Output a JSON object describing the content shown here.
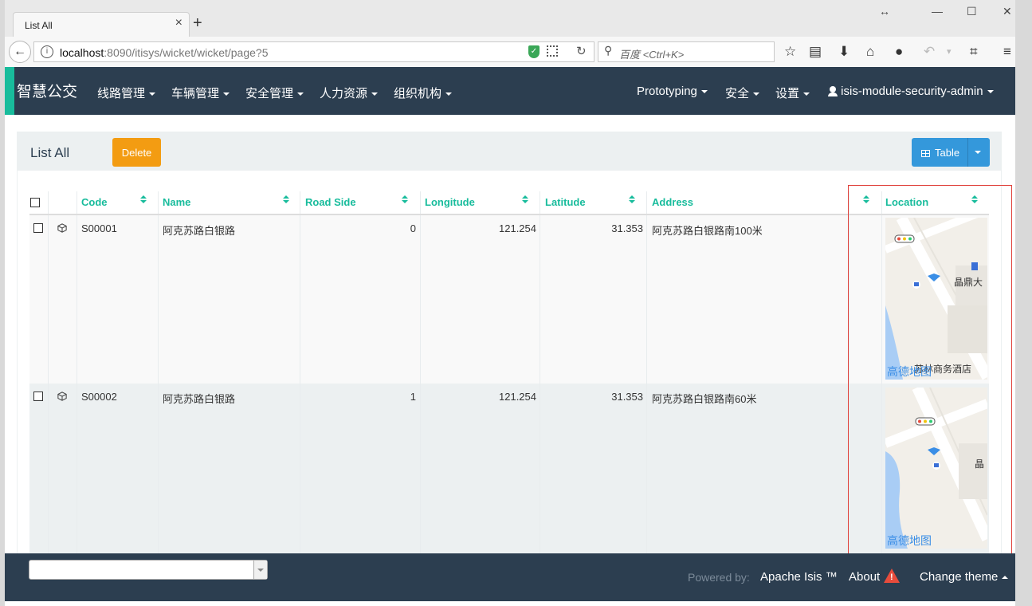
{
  "browser": {
    "tab_title": "List All",
    "tab_close": "×",
    "new_tab": "+",
    "url_host": "localhost",
    "url_rest": ":8090/itisys/wicket/wicket/page?5",
    "search_placeholder": "百度 <Ctrl+K>",
    "window_controls": [
      "↔",
      "—",
      "☐",
      "✕"
    ]
  },
  "app": {
    "brand": "智慧公交",
    "menus": [
      "线路管理",
      "车辆管理",
      "安全管理",
      "人力资源",
      "组织机构"
    ],
    "right_menus": [
      "Prototyping",
      "安全",
      "设置"
    ],
    "user": "isis-module-security-admin"
  },
  "panel": {
    "title": "List All",
    "delete_label": "Delete",
    "table_label": "Table"
  },
  "table": {
    "columns": [
      "Code",
      "Name",
      "Road Side",
      "Longitude",
      "Latitude",
      "Address",
      "",
      "Location"
    ],
    "rows": [
      {
        "code": "S00001",
        "name": "阿克苏路白银路",
        "road_side": "0",
        "longitude": "121.254",
        "latitude": "31.353",
        "address": "阿克苏路白银路南100米",
        "map_label_top": "晶鼎大",
        "map_label_bottom": "苏林商务酒店",
        "map_brand": "高德地图"
      },
      {
        "code": "S00002",
        "name": "阿克苏路白银路",
        "road_side": "1",
        "longitude": "121.254",
        "latitude": "31.353",
        "address": "阿克苏路白银路南60米",
        "map_label_top": "晶",
        "map_label_bottom": "",
        "map_brand": "高德地图"
      }
    ]
  },
  "footer": {
    "powered_by": "Powered by:",
    "apache": "Apache Isis ™",
    "about": "About",
    "change_theme": "Change theme",
    "warning_mark": "!"
  },
  "colors": {
    "navbar": "#2c3e50",
    "accent": "#18bc9c",
    "delete": "#f39c12",
    "table_button": "#3498db",
    "highlight_box": "#e0403a"
  }
}
